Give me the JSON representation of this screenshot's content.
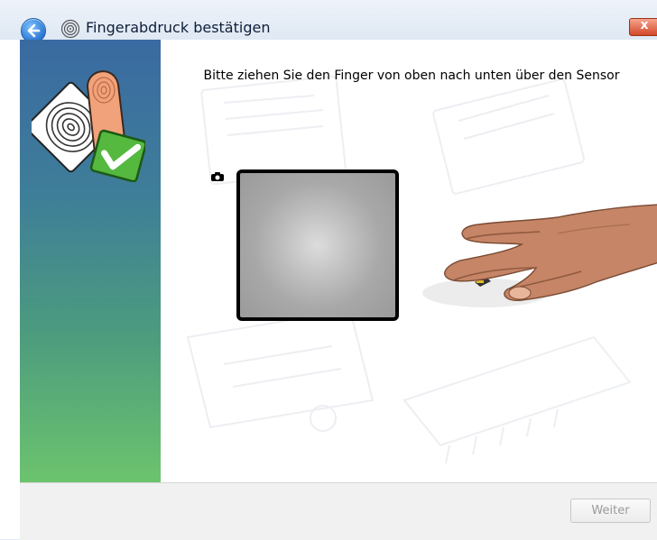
{
  "window": {
    "title": "Fingerabdruck bestätigen",
    "close_label": "x"
  },
  "icons": {
    "back": "back-arrow-icon",
    "title": "fingerprint-icon",
    "close": "close-icon",
    "wizard": "fingerprint-confirm-icon",
    "camera": "camera-icon"
  },
  "main": {
    "instruction": "Bitte ziehen Sie den Finger von oben nach unten über den Sensor"
  },
  "footer": {
    "next_label": "Weiter"
  },
  "colors": {
    "accent": "#2a76d2",
    "close": "#d2472a",
    "panel_top": "#3a6aa1",
    "panel_bottom": "#6cc36d"
  }
}
